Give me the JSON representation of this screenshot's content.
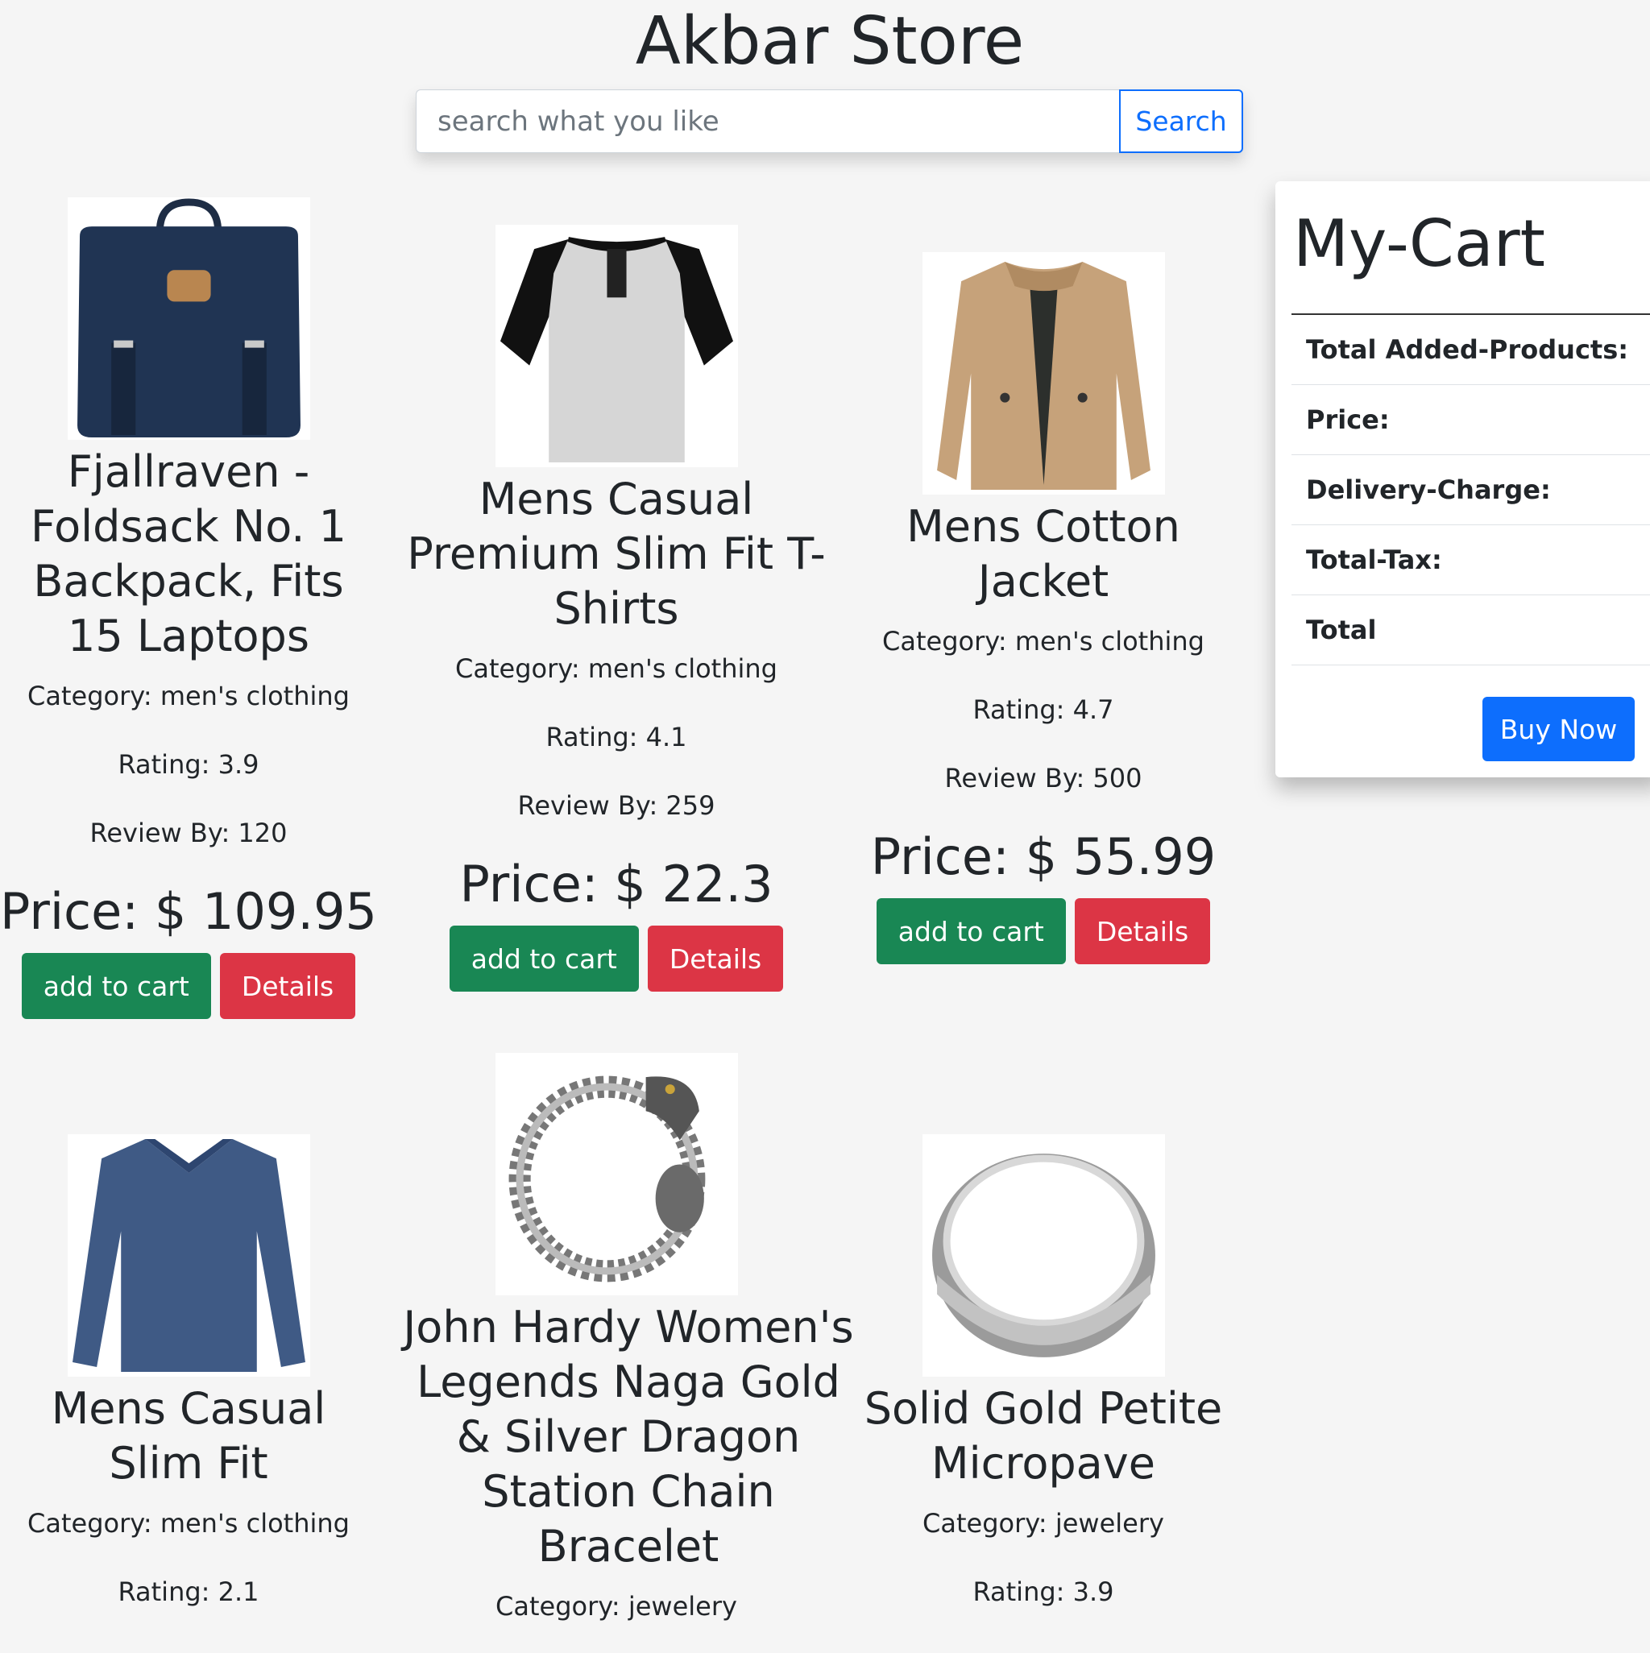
{
  "header": {
    "title": "Akbar Store"
  },
  "search": {
    "placeholder": "search what you like",
    "button_label": "Search"
  },
  "products": [
    {
      "name": "Fjallraven - Foldsack No. 1 Backpack, Fits 15 Laptops",
      "category": "Category: men's clothing",
      "rating": "Rating: 3.9",
      "review": "Review By: 120",
      "price": "Price: $ 109.95",
      "cart_label": "add to cart",
      "details_label": "Details"
    },
    {
      "name": "Mens Casual Premium Slim Fit T-Shirts",
      "category": "Category: men's clothing",
      "rating": "Rating: 4.1",
      "review": "Review By: 259",
      "price": "Price: $ 22.3",
      "cart_label": "add to cart",
      "details_label": "Details"
    },
    {
      "name": "Mens Cotton Jacket",
      "category": "Category: men's clothing",
      "rating": "Rating: 4.7",
      "review": "Review By: 500",
      "price": "Price: $ 55.99",
      "cart_label": "add to cart",
      "details_label": "Details"
    },
    {
      "name": "Mens Casual Slim Fit",
      "category": "Category: men's clothing",
      "rating": "Rating: 2.1"
    },
    {
      "name": "John Hardy Women's Legends Naga Gold & Silver Dragon Station Chain Bracelet",
      "category": "Category: jewelery"
    },
    {
      "name": "Solid Gold Petite Micropave",
      "category": "Category: jewelery",
      "rating": "Rating: 3.9"
    }
  ],
  "cart": {
    "title": "My-Cart",
    "rows": [
      "Total Added-Products:",
      "Price:",
      "Delivery-Charge:",
      "Total-Tax:",
      "Total"
    ],
    "buy_label": "Buy Now"
  },
  "icons": [
    "backpack-image",
    "tshirt-image",
    "jacket-image",
    "longsleeve-image",
    "bracelet-image",
    "ring-image"
  ]
}
